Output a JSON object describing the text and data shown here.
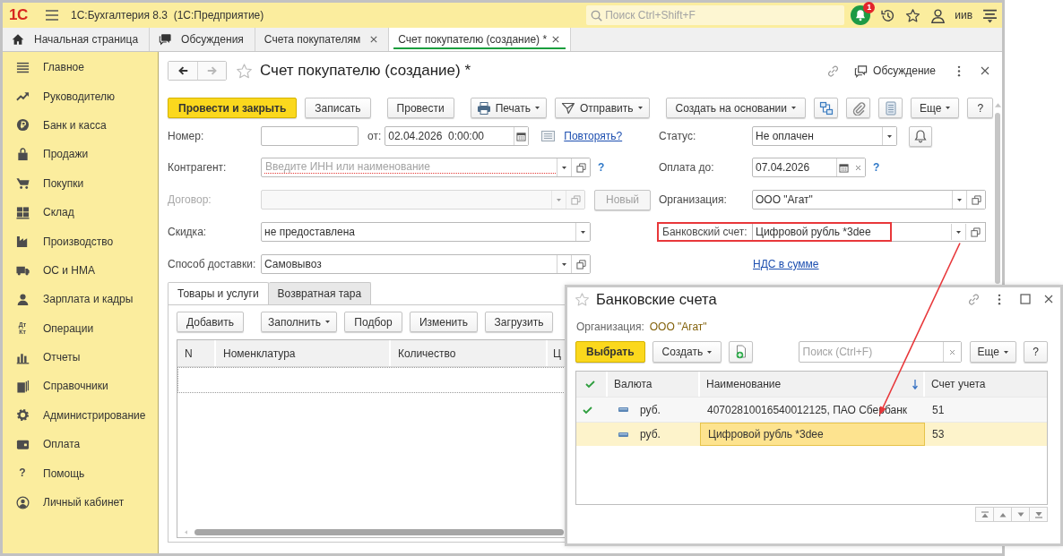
{
  "app": {
    "logo": "1С",
    "title": "1С:Бухгалтерия 8.3  (1С:Предприятие)",
    "search": {
      "placeholder": "Поиск Ctrl+Shift+F"
    },
    "notifications": "1",
    "user": "иив"
  },
  "tabs": [
    {
      "label": "Начальная страница",
      "kind": "home",
      "selected": false,
      "closable": false
    },
    {
      "label": "Обсуждения",
      "kind": "chat",
      "selected": false,
      "closable": false
    },
    {
      "label": "Счета покупателям",
      "kind": "page",
      "selected": false,
      "closable": true
    },
    {
      "label": "Счет покупателю (создание) *",
      "kind": "page",
      "selected": true,
      "closable": true
    }
  ],
  "sidebar": {
    "items": [
      {
        "label": "Главное"
      },
      {
        "label": "Руководителю"
      },
      {
        "label": "Банк и касса"
      },
      {
        "label": "Продажи"
      },
      {
        "label": "Покупки"
      },
      {
        "label": "Склад"
      },
      {
        "label": "Производство"
      },
      {
        "label": "ОС и НМА"
      },
      {
        "label": "Зарплата и кадры"
      },
      {
        "label": "Операции",
        "icon_text": "Дт Кт"
      },
      {
        "label": "Отчеты"
      },
      {
        "label": "Справочники"
      },
      {
        "label": "Администрирование"
      },
      {
        "label": "Оплата"
      },
      {
        "label": "Помощь",
        "icon_text": "?"
      },
      {
        "label": "Личный кабинет"
      }
    ]
  },
  "form": {
    "title": "Счет покупателю (создание) *",
    "discussion": "Обсуждение",
    "toolbar": [
      {
        "label": "Провести и закрыть",
        "kind": "primary",
        "dropdown": false
      },
      {
        "label": "Записать",
        "kind": "plain",
        "dropdown": false
      },
      {
        "label": "Провести",
        "kind": "plain",
        "dropdown": false
      },
      {
        "label": "Печать",
        "kind": "print",
        "dropdown": true
      },
      {
        "label": "Отправить",
        "kind": "send",
        "dropdown": true
      },
      {
        "label": "Создать на основании",
        "kind": "plain",
        "dropdown": true
      },
      {
        "kind": "structure",
        "dropdown": false
      },
      {
        "kind": "attach",
        "dropdown": false
      },
      {
        "kind": "list",
        "dropdown": false
      },
      {
        "label": "Еще",
        "kind": "more",
        "dropdown": true
      },
      {
        "label": "?",
        "kind": "plain",
        "dropdown": false
      }
    ],
    "number": {
      "label": "Номер:",
      "date_label": "от:",
      "date": "02.04.2026  0:00:00",
      "link": "Повторять?"
    },
    "counterparty": {
      "label": "Контрагент:",
      "placeholder": "Введите ИНН или наименование",
      "required": true,
      "help": "?"
    },
    "contract": {
      "label": "Договор:",
      "disabled": true,
      "button": "Новый"
    },
    "discount": {
      "label": "Скидка:",
      "value": "не предоставлена"
    },
    "delivery": {
      "label": "Способ доставки:",
      "value": "Самовывоз"
    },
    "status": {
      "label": "Статус:",
      "value": "Не оплачен"
    },
    "due_date": {
      "label": "Оплата до:",
      "value": "07.04.2026",
      "help": "?"
    },
    "organization": {
      "label": "Организация:",
      "value": "ООО \"Агат\""
    },
    "bank_account": {
      "label": "Банковский счет:",
      "value": "Цифровой рубль *3dee",
      "highlighted": true
    },
    "vat_link": "НДС в сумме",
    "section_tabs": [
      {
        "label": "Товары и услуги",
        "selected": true
      },
      {
        "label": "Возвратная тара",
        "selected": false
      }
    ],
    "table_toolbar": [
      {
        "label": "Добавить",
        "dropdown": false
      },
      {
        "label": "Заполнить",
        "dropdown": true
      },
      {
        "label": "Подбор",
        "dropdown": false
      },
      {
        "label": "Изменить",
        "dropdown": false
      },
      {
        "label": "Загрузить",
        "dropdown": false
      }
    ],
    "table": {
      "columns": [
        "N",
        "Номенклатура",
        "Количество",
        "Ц"
      ]
    }
  },
  "dialog": {
    "title": "Банковские счета",
    "org_label": "Организация:",
    "org_value": "ООО \"Агат\"",
    "toolbar": [
      {
        "label": "Выбрать",
        "kind": "primary",
        "dropdown": false
      },
      {
        "label": "Создать",
        "kind": "plain",
        "dropdown": true
      },
      {
        "kind": "add_file",
        "dropdown": false
      }
    ],
    "search": {
      "placeholder": "Поиск (Ctrl+F)"
    },
    "toolbar_right": [
      {
        "label": "Еще",
        "dropdown": true
      },
      {
        "label": "?",
        "dropdown": false
      }
    ],
    "table": {
      "columns": [
        {
          "kind": "check",
          "sorted": false
        },
        {
          "label": "Валюта",
          "kind": "text",
          "sorted": false
        },
        {
          "label": "Наименование",
          "kind": "text",
          "sorted": true
        },
        {
          "label": "Счет учета",
          "kind": "text",
          "sorted": false
        }
      ],
      "rows": [
        {
          "checked": true,
          "currency": "руб.",
          "name": "40702810016540012125, ПАО Сбербанк",
          "account": "51",
          "selected": false
        },
        {
          "checked": false,
          "currency": "руб.",
          "name": "Цифровой рубль *3dee",
          "account": "53",
          "selected": true
        }
      ]
    }
  }
}
